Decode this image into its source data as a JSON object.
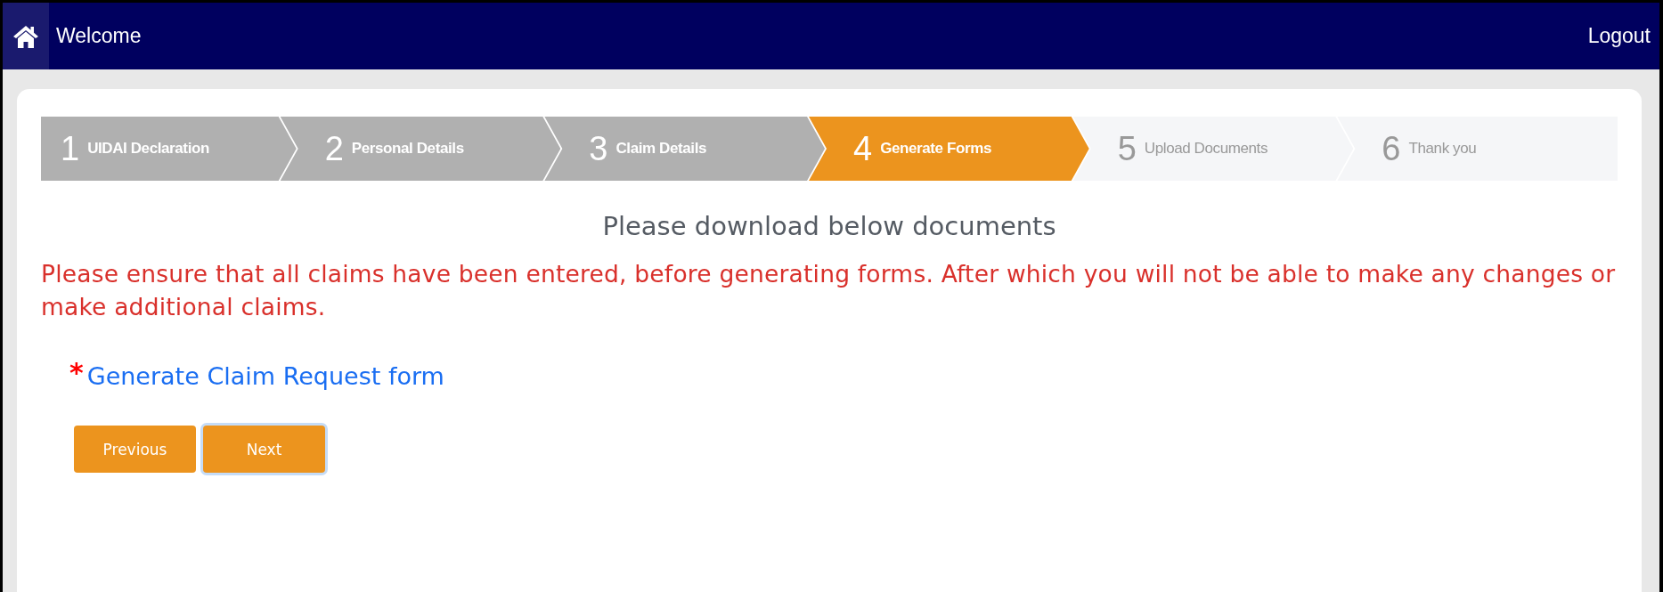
{
  "header": {
    "title": "Welcome",
    "logout": "Logout"
  },
  "steps": [
    {
      "number": "1",
      "label": "UIDAI Declaration",
      "completed": true,
      "selected": false
    },
    {
      "number": "2",
      "label": "Personal Details",
      "completed": true,
      "selected": false
    },
    {
      "number": "3",
      "label": "Claim Details",
      "completed": true,
      "selected": false
    },
    {
      "number": "4",
      "label": "Generate Forms",
      "completed": false,
      "selected": true
    },
    {
      "number": "5",
      "label": "Upload Documents",
      "completed": false,
      "selected": false
    },
    {
      "number": "6",
      "label": "Thank you",
      "completed": false,
      "selected": false
    }
  ],
  "heading": "Please download below documents",
  "warning": "Please ensure that all claims have been entered, before generating forms. After which you will not be able to make any changes or make additional claims.",
  "required_mark": "*",
  "link": "Generate Claim Request form",
  "buttons": [
    {
      "label": "Previous",
      "focused": false
    },
    {
      "label": "Next",
      "focused": true
    }
  ]
}
